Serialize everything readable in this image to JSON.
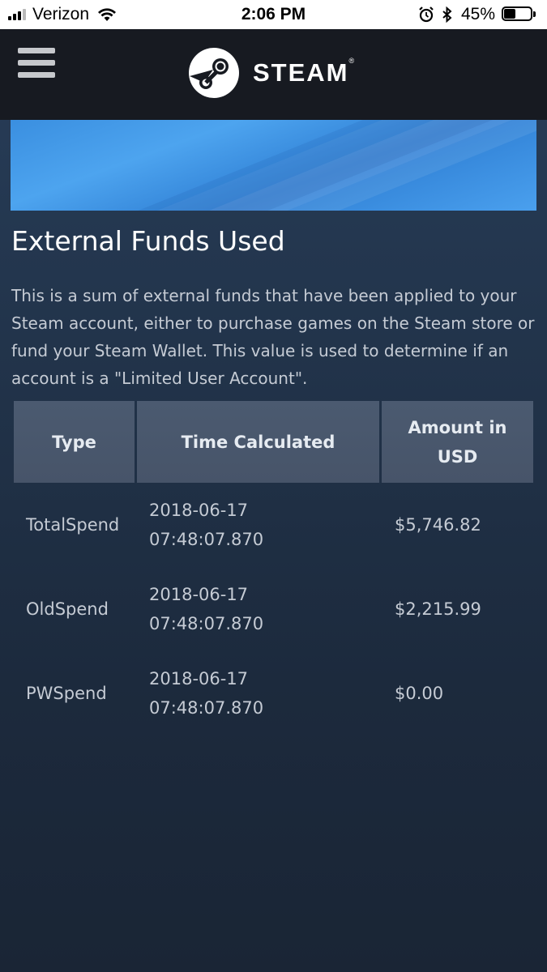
{
  "status_bar": {
    "carrier": "Verizon",
    "time": "2:06 PM",
    "battery_percent": "45%",
    "battery_level": 0.45,
    "icons": [
      "signal-icon",
      "wifi-icon",
      "alarm-icon",
      "bluetooth-icon",
      "battery-icon"
    ]
  },
  "header": {
    "brand": "STEAM",
    "brand_mark": "®",
    "menu_icon": "hamburger-menu-icon",
    "logo_icon": "steam-logo-icon",
    "background_color": "#171a21"
  },
  "section": {
    "title": "External Funds Used",
    "description": "This is a sum of external funds that have been applied to your Steam account, either to purchase games on the Steam store or fund your Steam Wallet. This value is used to determine if an account is a \"Limited User Account\"."
  },
  "table": {
    "headers": [
      "Type",
      "Time Calculated",
      "Amount in USD"
    ],
    "rows": [
      {
        "type": "TotalSpend",
        "time": "2018-06-17\n07:48:07.870",
        "amount": "$5,746.82"
      },
      {
        "type": "OldSpend",
        "time": "2018-06-17\n07:48:07.870",
        "amount": "$2,215.99"
      },
      {
        "type": "PWSpend",
        "time": "2018-06-17\n07:48:07.870",
        "amount": "$0.00"
      }
    ]
  },
  "colors": {
    "accent_blue": "#3a8fe0",
    "table_header": "#4a5568",
    "text_muted": "#c5cbd4"
  }
}
